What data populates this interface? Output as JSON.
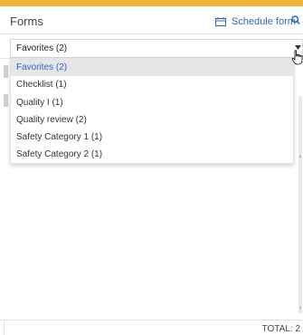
{
  "colors": {
    "accent": "#efb332",
    "link": "#2b66c4",
    "selected_bg": "#e6e6e6",
    "scrollbar": "#e9e9e9"
  },
  "header": {
    "title": "Forms",
    "schedule_label": "Schedule form",
    "schedule_icon": "calendar-icon",
    "search_icon": "search-icon"
  },
  "select": {
    "value": "Favorites (2)",
    "arrow_icon": "caret-down-icon"
  },
  "dropdown": {
    "options": [
      "Favorites (2)",
      "Checklist (1)",
      "Quality I (1)",
      "Quality review (2)",
      "Safety Category 1 (1)",
      "Safety Category 2 (1)"
    ],
    "selected_index": 0
  },
  "footer": {
    "total_label": "TOTAL: 2"
  }
}
